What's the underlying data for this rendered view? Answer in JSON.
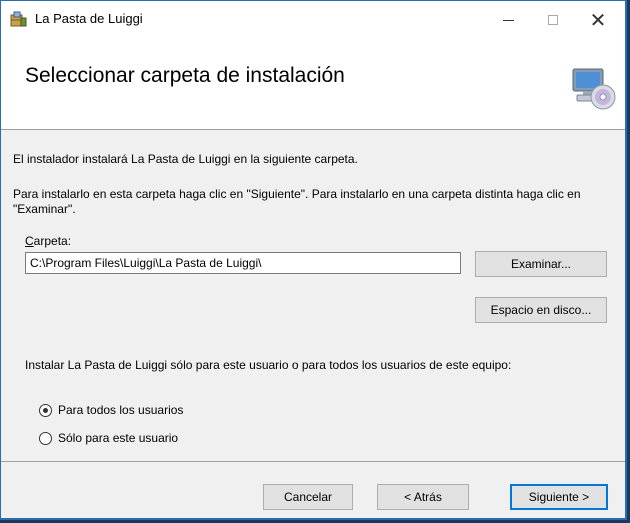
{
  "window": {
    "title": "La Pasta de Luiggi",
    "controls": {
      "minimize": "—",
      "close": "✕"
    }
  },
  "header": {
    "title": "Seleccionar carpeta de instalación",
    "icon": "computer-cd-icon"
  },
  "content": {
    "line1": "El instalador instalará La Pasta de Luiggi en la siguiente carpeta.",
    "line2": "Para instalarlo en esta carpeta haga clic en \"Siguiente\". Para instalarlo en una carpeta distinta haga clic en \"Examinar\".",
    "folder_label_accel": "C",
    "folder_label_rest": "arpeta:",
    "folder_value": "C:\\Program Files\\Luiggi\\La Pasta de Luiggi\\",
    "browse_label": "Examinar...",
    "disk_label": "Espacio en disco...",
    "install_for": "Instalar La Pasta de Luiggi sólo para este usuario o para todos los usuarios de este equipo:",
    "radio_all": "Para todos los usuarios",
    "radio_me": "Sólo para este usuario",
    "radio_selected": "all"
  },
  "footer": {
    "cancel": "Cancelar",
    "back": "< Atrás",
    "next": "Siguiente >"
  }
}
